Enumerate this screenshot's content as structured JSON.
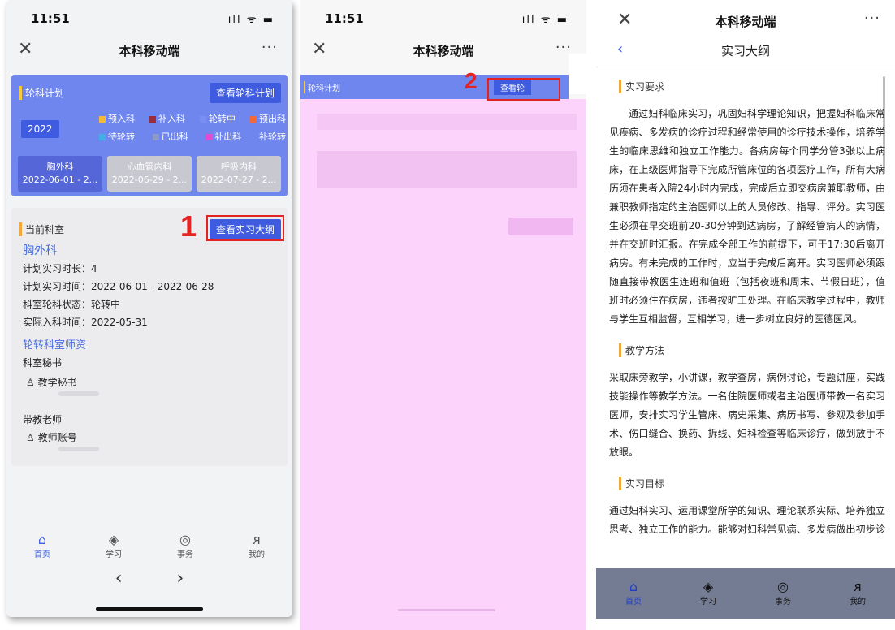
{
  "panel1": {
    "status_time": "11:51",
    "status_icons": "ıll ᯤ ▬",
    "nav_close": "✕",
    "nav_title": "本科移动端",
    "nav_more": "···",
    "plan_title": "轮科计划",
    "view_plan_label": "查看轮科计划",
    "year": "2022",
    "legend": [
      {
        "label": "预入科",
        "color": "#f6b73c"
      },
      {
        "label": "补入科",
        "color": "#9b2d38"
      },
      {
        "label": "轮转中",
        "color": "#7b8ff2"
      },
      {
        "label": "预出科",
        "color": "#f06a3c"
      },
      {
        "label": "待轮转",
        "color": "#3fb0e6"
      },
      {
        "label": "已出科",
        "color": "#8d99c7"
      },
      {
        "label": "补出科",
        "color": "#e24bd2"
      },
      {
        "label": "补轮转",
        "color": "#6f86ee"
      }
    ],
    "depts": [
      {
        "name": "胸外科",
        "dates": "2022-06-01 - 2...",
        "bg": "#5466d8"
      },
      {
        "name": "心血管内科",
        "dates": "2022-06-29 - 2...",
        "bg": "#c8c9d0"
      },
      {
        "name": "呼吸内科",
        "dates": "2022-07-27 - 2...",
        "bg": "#c8c9d0"
      }
    ],
    "current_title": "当前科室",
    "view_outline_label": "查看实习大纲",
    "current_dept": "胸外科",
    "info_lines": [
      "计划实习时长：4",
      "计划实习时间：2022-06-01 - 2022-06-28",
      "科室轮科状态：轮转中",
      "实际入科时间：2022-05-31"
    ],
    "teachers_title": "轮转科室师资",
    "secretary_label": "科室秘书",
    "secretary_name": "教学秘书",
    "teacher_label": "带教老师",
    "teacher_name": "教师账号",
    "annot_num": "1",
    "tabs": [
      {
        "icon": "⌂",
        "label": "首页"
      },
      {
        "icon": "◈",
        "label": "学习"
      },
      {
        "icon": "◎",
        "label": "事务"
      },
      {
        "icon": "ᴙ",
        "label": "我的"
      }
    ],
    "browser_back": "‹",
    "browser_fwd": "›"
  },
  "panel2": {
    "status_time": "11:51",
    "status_icons": "ıll ᯤ ▬",
    "nav_close": "✕",
    "nav_title": "本科移动端",
    "nav_more": "···",
    "plan_title": "轮科计划",
    "view_plan_label": "查看轮",
    "annot_num": "2"
  },
  "panel3": {
    "nav_close": "✕",
    "nav_title": "本科移动端",
    "nav_more": "···",
    "back": "‹",
    "page_title": "实习大纲",
    "sections": [
      {
        "title": "实习要求",
        "text": "通过妇科临床实习，巩固妇科学理论知识，把握妇科临床常见疾病、多发病的诊疗过程和经常使用的诊疗技术操作，培养学生的临床思维和独立工作能力。各病房每个同学分管3张以上病床，在上级医师指导下完成所管床位的各项医疗工作，所有大病历须在患者入院24小时内完成，完成后立即交病房兼职教师，由兼职教师指定的主治医师以上的人员修改、指导、评分。实习医生必须在早交班前20-30分钟到达病房，了解经管病人的病情，并在交班时汇报。在完成全部工作的前提下，可于17:30后离开病房。有未完成的工作时，应当于完成后离开。实习医师必须跟随直接带教医生连班和值班（包括夜班和周末、节假日班），值班时必须住在病房，违者按旷工处理。在临床教学过程中，教师与学生互相监督，互相学习，进一步树立良好的医德医风。"
      },
      {
        "title": "教学方法",
        "text": "采取床旁教学，小讲课，教学查房，病例讨论，专题讲座，实践技能操作等教学方法。一名住院医师或者主治医师带教一名实习医师，安排实习学生管床、病史采集、病历书写、参观及参加手术、伤口缝合、换药、拆线、妇科检查等临床诊疗，做到放手不放眼。"
      },
      {
        "title": "实习目标",
        "text": "通过妇科实习、运用课堂所学的知识、理论联系实际、培养独立思考、独立工作的能力。能够对妇科常见病、多发病做出初步诊断、"
      }
    ],
    "tabs": [
      {
        "icon": "⌂",
        "label": "首页"
      },
      {
        "icon": "◈",
        "label": "学习"
      },
      {
        "icon": "◎",
        "label": "事务"
      },
      {
        "icon": "ᴙ",
        "label": "我的"
      }
    ]
  }
}
